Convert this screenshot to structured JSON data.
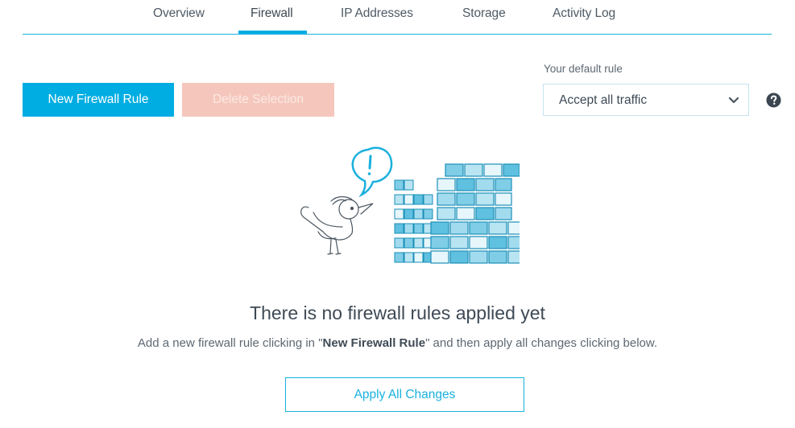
{
  "tabs": [
    {
      "label": "Overview",
      "active": false
    },
    {
      "label": "Firewall",
      "active": true
    },
    {
      "label": "IP Addresses",
      "active": false
    },
    {
      "label": "Storage",
      "active": false
    },
    {
      "label": "Activity Log",
      "active": false
    }
  ],
  "toolbar": {
    "new_rule_label": "New Firewall Rule",
    "delete_label": "Delete Selection"
  },
  "default_rule": {
    "label": "Your default rule",
    "selected": "Accept all traffic",
    "help_icon": "question-circle-icon"
  },
  "empty_state": {
    "illustration": "bird-with-exclamation-and-brick-wall",
    "title": "There is no firewall rules applied yet",
    "desc_prefix": "Add a new firewall rule clicking in \"",
    "desc_bold": "New Firewall Rule",
    "desc_suffix": "\" and then apply all changes clicking below."
  },
  "apply_label": "Apply All Changes",
  "colors": {
    "accent": "#00ade2",
    "delete_disabled": "#f5c7bc",
    "text": "#3e4a55"
  }
}
